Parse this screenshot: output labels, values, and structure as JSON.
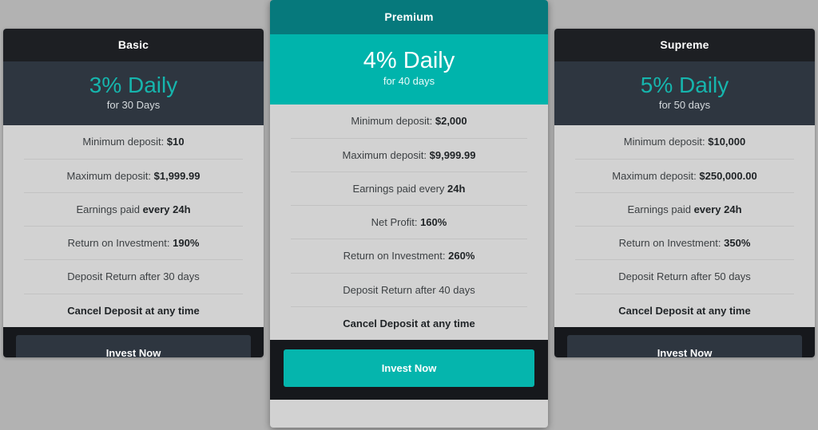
{
  "page": {
    "background_color": "#b2b2b2"
  },
  "colors": {
    "accent_teal": "#16b5ad",
    "premium_header": "#06797c",
    "premium_price_band": "#00b4ac",
    "dark_header": "#1d1f23",
    "dark_price_band": "#2e3640",
    "card_body": "#d2d2d2",
    "footer": "#16181c"
  },
  "plans": [
    {
      "id": "basic",
      "title": "Basic",
      "price_main": "3% Daily",
      "price_sub": "for 30 Days",
      "features": [
        {
          "text": "Minimum deposit: ",
          "strong": "$10",
          "all_bold": false
        },
        {
          "text": "Maximum deposit: ",
          "strong": "$1,999.99",
          "all_bold": false
        },
        {
          "text": "Earnings paid ",
          "strong": "every 24h",
          "all_bold": false
        },
        {
          "text": "Return on Investment: ",
          "strong": "190%",
          "all_bold": false
        },
        {
          "text": "Deposit Return after 30 days",
          "strong": "",
          "all_bold": false
        },
        {
          "text": "Cancel Deposit at any time",
          "strong": "",
          "all_bold": true
        }
      ],
      "cta_label": "Invest Now"
    },
    {
      "id": "premium",
      "title": "Premium",
      "price_main": "4% Daily",
      "price_sub": "for 40 days",
      "features": [
        {
          "text": "Minimum deposit: ",
          "strong": "$2,000",
          "all_bold": false
        },
        {
          "text": "Maximum deposit: ",
          "strong": "$9,999.99",
          "all_bold": false
        },
        {
          "text": "Earnings paid every ",
          "strong": "24h",
          "all_bold": false
        },
        {
          "text": "Net Profit: ",
          "strong": "160%",
          "all_bold": false
        },
        {
          "text": "Return on Investment: ",
          "strong": "260%",
          "all_bold": false
        },
        {
          "text": "Deposit Return after 40 days",
          "strong": "",
          "all_bold": false
        },
        {
          "text": "Cancel Deposit at any time",
          "strong": "",
          "all_bold": true
        }
      ],
      "cta_label": "Invest Now"
    },
    {
      "id": "supreme",
      "title": "Supreme",
      "price_main": "5% Daily",
      "price_sub": "for 50 days",
      "features": [
        {
          "text": "Minimum deposit: ",
          "strong": "$10,000",
          "all_bold": false
        },
        {
          "text": "Maximum deposit: ",
          "strong": "$250,000.00",
          "all_bold": false
        },
        {
          "text": "Earnings paid ",
          "strong": "every 24h",
          "all_bold": false
        },
        {
          "text": "Return on Investment: ",
          "strong": "350%",
          "all_bold": false
        },
        {
          "text": "Deposit Return after 50 days",
          "strong": "",
          "all_bold": false
        },
        {
          "text": "Cancel Deposit at any time",
          "strong": "",
          "all_bold": true
        }
      ],
      "cta_label": "Invest Now"
    }
  ]
}
